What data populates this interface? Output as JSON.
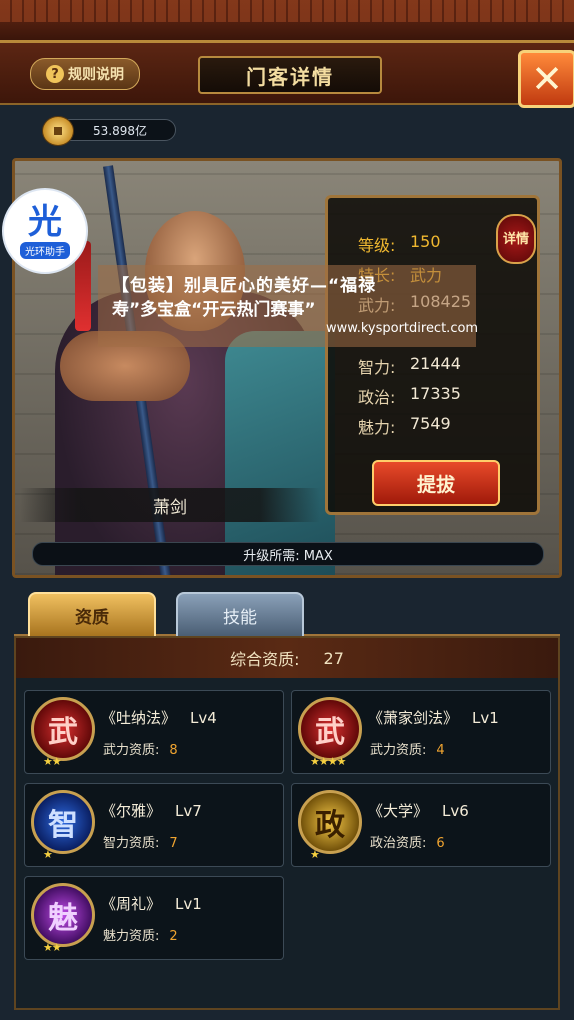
{
  "header": {
    "rules_label": "规则说明",
    "title": "门客详情"
  },
  "currency": {
    "amount": "53.898亿"
  },
  "logo": {
    "glyph": "光",
    "text": "光环助手"
  },
  "hero": {
    "name": "萧剑",
    "stats": [
      {
        "key": "等级:",
        "value": "150",
        "highlight": true
      },
      {
        "key": "特长:",
        "value": "武力",
        "highlight": true
      },
      {
        "key": "武力:",
        "value": "108425",
        "highlight": false
      },
      {
        "key": "智力:",
        "value": "21444",
        "highlight": false
      },
      {
        "key": "政治:",
        "value": "17335",
        "highlight": false
      },
      {
        "key": "魅力:",
        "value": "7549",
        "highlight": false
      }
    ],
    "detail_label": "详情",
    "promote_label": "提拔",
    "upgrade_text": "升级所需: MAX"
  },
  "watermark": {
    "line1": "【包装】别具匠心的美好—“福禄",
    "line2": "寿”多宝盒“开云热门赛事”",
    "line3": "www.kysportdirect.com"
  },
  "tabs": [
    {
      "label": "资质",
      "active": true
    },
    {
      "label": "技能",
      "active": false
    }
  ],
  "aptitude": {
    "label": "综合资质:",
    "value": "27"
  },
  "skills": [
    {
      "glyph": "武",
      "color": "red",
      "stars": "★★",
      "name": "《吐纳法》",
      "level": "Lv4",
      "attr": "武力资质:",
      "num": "8"
    },
    {
      "glyph": "武",
      "color": "red",
      "stars": "★★★★",
      "name": "《萧家剑法》",
      "level": "Lv1",
      "attr": "武力资质:",
      "num": "4"
    },
    {
      "glyph": "智",
      "color": "blue",
      "stars": "★",
      "name": "《尔雅》",
      "level": "Lv7",
      "attr": "智力资质:",
      "num": "7"
    },
    {
      "glyph": "政",
      "color": "gold",
      "stars": "★",
      "name": "《大学》",
      "level": "Lv6",
      "attr": "政治资质:",
      "num": "6"
    },
    {
      "glyph": "魅",
      "color": "purple",
      "stars": "★★",
      "name": "《周礼》",
      "level": "Lv1",
      "attr": "魅力资质:",
      "num": "2"
    }
  ]
}
